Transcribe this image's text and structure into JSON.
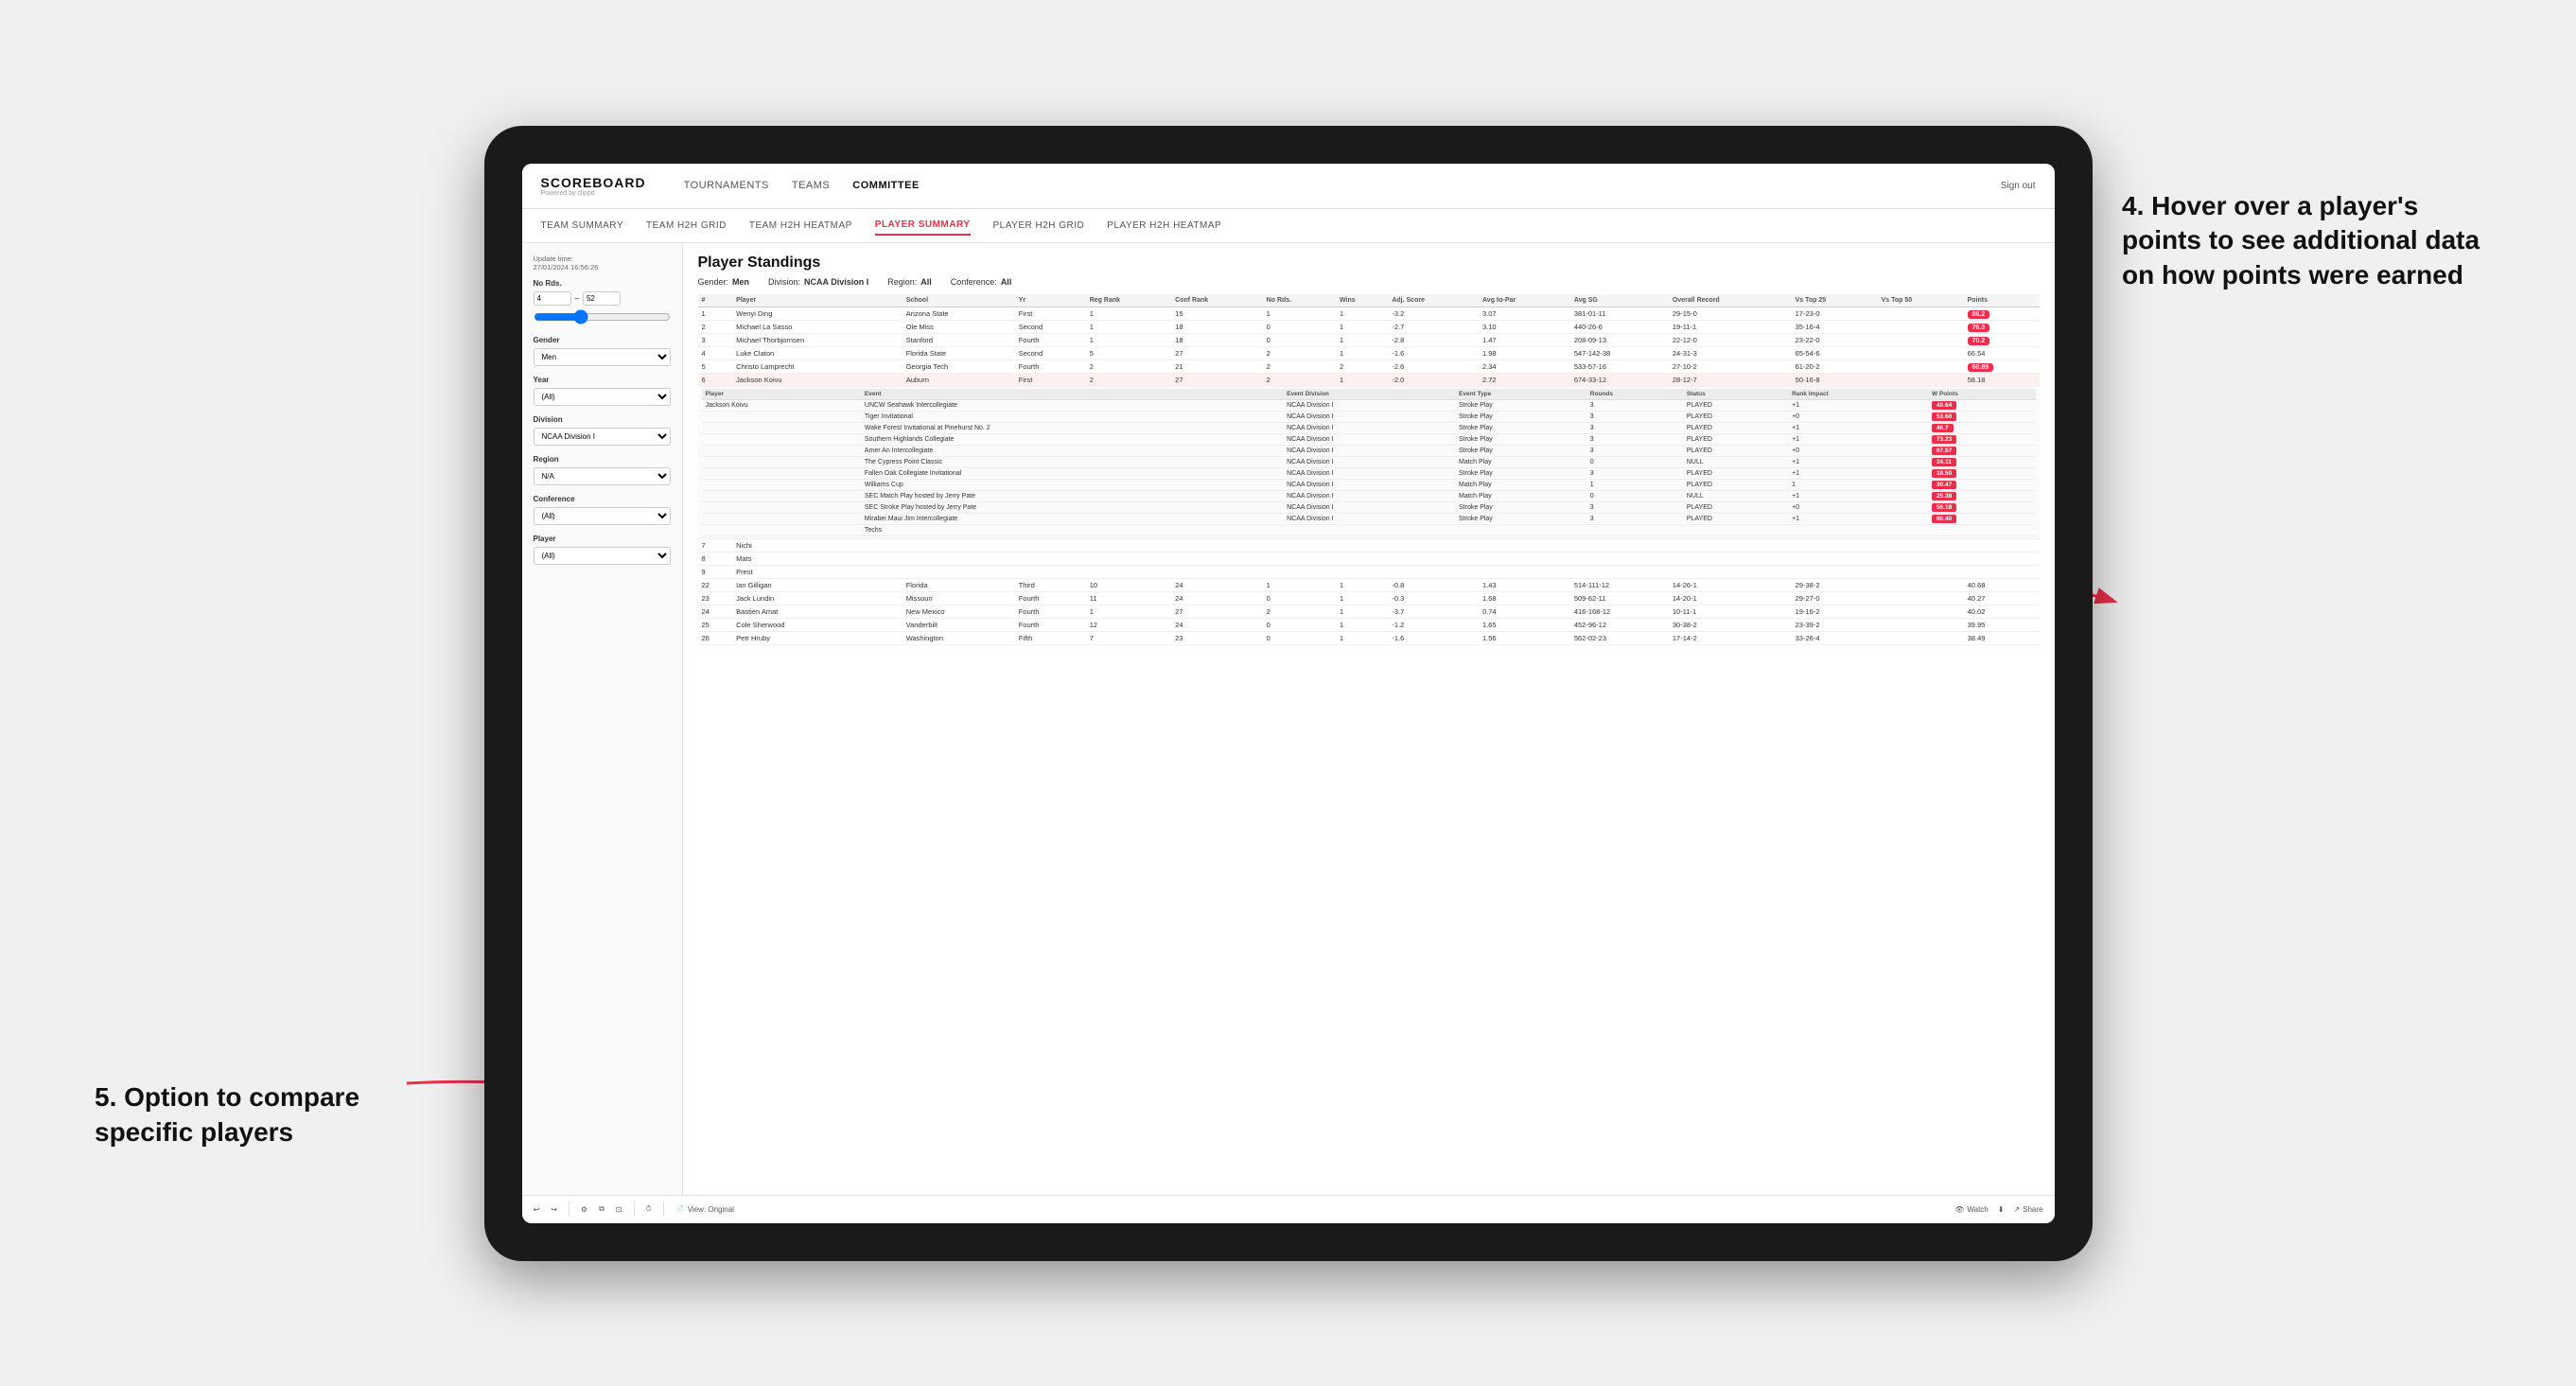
{
  "brand": {
    "title": "SCOREBOARD",
    "sub": "Powered by clippd"
  },
  "nav": {
    "items": [
      "TOURNAMENTS",
      "TEAMS",
      "COMMITTEE"
    ],
    "right": [
      "Sign out"
    ]
  },
  "subnav": {
    "items": [
      "TEAM SUMMARY",
      "TEAM H2H GRID",
      "TEAM H2H HEATMAP",
      "PLAYER SUMMARY",
      "PLAYER H2H GRID",
      "PLAYER H2H HEATMAP"
    ],
    "active": "PLAYER SUMMARY"
  },
  "sidebar": {
    "update_time_label": "Update time:",
    "update_time": "27/01/2024 16:56:26",
    "no_rds_label": "No Rds.",
    "no_rds_min": "4",
    "no_rds_max": "52",
    "gender_label": "Gender",
    "gender_value": "Men",
    "year_label": "Year",
    "year_value": "(All)",
    "division_label": "Division",
    "division_value": "NCAA Division I",
    "region_label": "Region",
    "region_value": "N/A",
    "conference_label": "Conference",
    "conference_value": "(All)",
    "player_label": "Player",
    "player_value": "(All)"
  },
  "standings": {
    "title": "Player Standings",
    "gender": "Men",
    "division": "NCAA Division I",
    "region": "All",
    "conference": "All",
    "columns": [
      "#",
      "Player",
      "School",
      "Yr",
      "Reg Rank",
      "Conf Rank",
      "No Rds.",
      "Wins",
      "Adj. Score",
      "Avg to-Par",
      "Avg SG",
      "Overall Record",
      "Vs Top 25",
      "Vs Top 50",
      "Points"
    ],
    "rows": [
      {
        "num": 1,
        "player": "Wenyi Ding",
        "school": "Arizona State",
        "yr": "First",
        "reg_rank": 1,
        "conf_rank": 15,
        "rds": 1,
        "wins": 1,
        "adj_score": "-3.2",
        "to_par": "3.07",
        "avg_sg": "381-01-11",
        "record": "29-15-0",
        "vs25": "17-23-0",
        "vs50": "",
        "points": "88.2",
        "points_color": "red"
      },
      {
        "num": 2,
        "player": "Michael La Sasso",
        "school": "Ole Miss",
        "yr": "Second",
        "reg_rank": 1,
        "conf_rank": 18,
        "rds": 0,
        "wins": 1,
        "adj_score": "-2.7",
        "to_par": "3.10",
        "avg_sg": "440-26-6",
        "record": "19-11-1",
        "vs25": "35-16-4",
        "vs50": "",
        "points": "76.3",
        "points_color": "red"
      },
      {
        "num": 3,
        "player": "Michael Thorbjornsen",
        "school": "Stanford",
        "yr": "Fourth",
        "reg_rank": 1,
        "conf_rank": 18,
        "rds": 0,
        "wins": 1,
        "adj_score": "-2.8",
        "to_par": "1.47",
        "avg_sg": "208-09-13",
        "record": "22-12-0",
        "vs25": "23-22-0",
        "vs50": "",
        "points": "70.2",
        "points_color": "red"
      },
      {
        "num": 4,
        "player": "Luke Claton",
        "school": "Florida State",
        "yr": "Second",
        "reg_rank": 5,
        "conf_rank": 27,
        "rds": 2,
        "wins": 1,
        "adj_score": "-1.6",
        "to_par": "1.98",
        "avg_sg": "547-142-38",
        "record": "24-31-3",
        "vs25": "65-54-6",
        "vs50": "",
        "points": "66.54",
        "points_color": "normal"
      },
      {
        "num": 5,
        "player": "Christo Lamprecht",
        "school": "Georgia Tech",
        "yr": "Fourth",
        "reg_rank": 2,
        "conf_rank": 21,
        "rds": 2,
        "wins": 2,
        "adj_score": "-2.6",
        "to_par": "2.34",
        "avg_sg": "533-57-16",
        "record": "27-10-2",
        "vs25": "61-20-2",
        "vs50": "",
        "points": "60.89",
        "points_color": "red"
      },
      {
        "num": 6,
        "player": "Jackson Koivu",
        "school": "Auburn",
        "yr": "First",
        "reg_rank": 2,
        "conf_rank": 27,
        "rds": 2,
        "wins": 1,
        "adj_score": "-2.0",
        "to_par": "2.72",
        "avg_sg": "674-33-12",
        "record": "28-12-7",
        "vs25": "50-16-8",
        "vs50": "",
        "points": "58.18",
        "points_color": "normal"
      },
      {
        "num": 7,
        "player": "Nichi",
        "school": "",
        "yr": "",
        "reg_rank": "",
        "conf_rank": "",
        "rds": "",
        "wins": "",
        "adj_score": "",
        "to_par": "",
        "avg_sg": "",
        "record": "",
        "vs25": "",
        "vs50": "",
        "points": "",
        "points_color": "normal"
      },
      {
        "num": 8,
        "player": "Mats",
        "school": "",
        "yr": "",
        "reg_rank": "",
        "conf_rank": "",
        "rds": "",
        "wins": "",
        "adj_score": "",
        "to_par": "",
        "avg_sg": "",
        "record": "",
        "vs25": "",
        "vs50": "",
        "points": "",
        "points_color": "normal"
      },
      {
        "num": 9,
        "player": "Prest",
        "school": "",
        "yr": "",
        "reg_rank": "",
        "conf_rank": "",
        "rds": "",
        "wins": "",
        "adj_score": "",
        "to_par": "",
        "avg_sg": "",
        "record": "",
        "vs25": "",
        "vs50": "",
        "points": "",
        "points_color": "normal"
      }
    ],
    "expanded_player": "Jackson Koivu",
    "expanded_events": [
      {
        "player": "Jackson Koivu",
        "event": "UNCW Seahawk Intercollegiate",
        "event_division": "NCAA Division I",
        "event_type": "Stroke Play",
        "rounds": 3,
        "status": "PLAYED",
        "rank_impact": "+1",
        "w_points": "40.64"
      },
      {
        "player": "",
        "event": "Tiger Invitational",
        "event_division": "NCAA Division I",
        "event_type": "Stroke Play",
        "rounds": 3,
        "status": "PLAYED",
        "rank_impact": "+0",
        "w_points": "53.60"
      },
      {
        "player": "",
        "event": "Wake Forest Invitational at Pinehurst No. 2",
        "event_division": "NCAA Division I",
        "event_type": "Stroke Play",
        "rounds": 3,
        "status": "PLAYED",
        "rank_impact": "+1",
        "w_points": "46.7"
      },
      {
        "player": "",
        "event": "Southern Highlands Collegiate",
        "event_division": "NCAA Division I",
        "event_type": "Stroke Play",
        "rounds": 3,
        "status": "PLAYED",
        "rank_impact": "+1",
        "w_points": "73.23"
      },
      {
        "player": "",
        "event": "Amer An Intercollegiate",
        "event_division": "NCAA Division I",
        "event_type": "Stroke Play",
        "rounds": 3,
        "status": "PLAYED",
        "rank_impact": "+0",
        "w_points": "67.57"
      },
      {
        "player": "",
        "event": "The Cypress Point Classic",
        "event_division": "NCAA Division I",
        "event_type": "Match Play",
        "rounds": 0,
        "status": "NULL",
        "rank_impact": "+1",
        "w_points": "24.11"
      },
      {
        "player": "",
        "event": "Fallen Oak Collegiate Invitational",
        "event_division": "NCAA Division I",
        "event_type": "Stroke Play",
        "rounds": 3,
        "status": "PLAYED",
        "rank_impact": "+1",
        "w_points": "18.50"
      },
      {
        "player": "",
        "event": "Williams Cup",
        "event_division": "NCAA Division I",
        "event_type": "Match Play",
        "rounds": 1,
        "status": "PLAYED",
        "rank_impact": "1",
        "w_points": "30.47"
      },
      {
        "player": "",
        "event": "SEC Match Play hosted by Jerry Pate",
        "event_division": "NCAA Division I",
        "event_type": "Match Play",
        "rounds": 0,
        "status": "NULL",
        "rank_impact": "+1",
        "w_points": "25.38"
      },
      {
        "player": "",
        "event": "SEC Stroke Play hosted by Jerry Pate",
        "event_division": "NCAA Division I",
        "event_type": "Stroke Play",
        "rounds": 3,
        "status": "PLAYED",
        "rank_impact": "+0",
        "w_points": "56.18"
      },
      {
        "player": "",
        "event": "Mirabei Maui Jim Intercollegiate",
        "event_division": "NCAA Division I",
        "event_type": "Stroke Play",
        "rounds": 3,
        "status": "PLAYED",
        "rank_impact": "+1",
        "w_points": "66.40"
      },
      {
        "player": "",
        "event": "Techs",
        "event_division": "",
        "event_type": "",
        "rounds": "",
        "status": "",
        "rank_impact": "",
        "w_points": ""
      }
    ],
    "more_rows": [
      {
        "num": 22,
        "player": "Ian Gilligan",
        "school": "Florida",
        "yr": "Third",
        "reg_rank": 10,
        "conf_rank": 24,
        "rds": 1,
        "wins": 1,
        "adj_score": "-0.8",
        "to_par": "1.43",
        "avg_sg": "514-111-12",
        "record": "14-26-1",
        "vs25": "29-38-2",
        "vs50": "",
        "points": "40.68"
      },
      {
        "num": 23,
        "player": "Jack Lundin",
        "school": "Missouri",
        "yr": "Fourth",
        "reg_rank": 11,
        "conf_rank": 24,
        "rds": 0,
        "wins": 1,
        "adj_score": "-0.3",
        "to_par": "1.68",
        "avg_sg": "509-62-11",
        "record": "14-20-1",
        "vs25": "29-27-0",
        "vs50": "",
        "points": "40.27"
      },
      {
        "num": 24,
        "player": "Bastien Amat",
        "school": "New Mexico",
        "yr": "Fourth",
        "reg_rank": 1,
        "conf_rank": 27,
        "rds": 2,
        "wins": 1,
        "adj_score": "-3.7",
        "to_par": "0.74",
        "avg_sg": "416-168-12",
        "record": "10-11-1",
        "vs25": "19-16-2",
        "vs50": "",
        "points": "40.02"
      },
      {
        "num": 25,
        "player": "Cole Sherwood",
        "school": "Vanderbilt",
        "yr": "Fourth",
        "reg_rank": 12,
        "conf_rank": 24,
        "rds": 0,
        "wins": 1,
        "adj_score": "-1.2",
        "to_par": "1.65",
        "avg_sg": "452-96-12",
        "record": "30-38-2",
        "vs25": "23-39-2",
        "vs50": "",
        "points": "39.95"
      },
      {
        "num": 26,
        "player": "Petr Hruby",
        "school": "Washington",
        "yr": "Fifth",
        "reg_rank": 7,
        "conf_rank": 23,
        "rds": 0,
        "wins": 1,
        "adj_score": "-1.6",
        "to_par": "1.56",
        "avg_sg": "562-02-23",
        "record": "17-14-2",
        "vs25": "33-26-4",
        "vs50": "",
        "points": "38.49"
      }
    ]
  },
  "toolbar": {
    "view_original": "View: Original",
    "watch": "Watch",
    "share": "Share"
  },
  "annotations": {
    "annotation1": "4. Hover over a player's points to see additional data on how points were earned",
    "annotation2": "5. Option to compare specific players"
  }
}
